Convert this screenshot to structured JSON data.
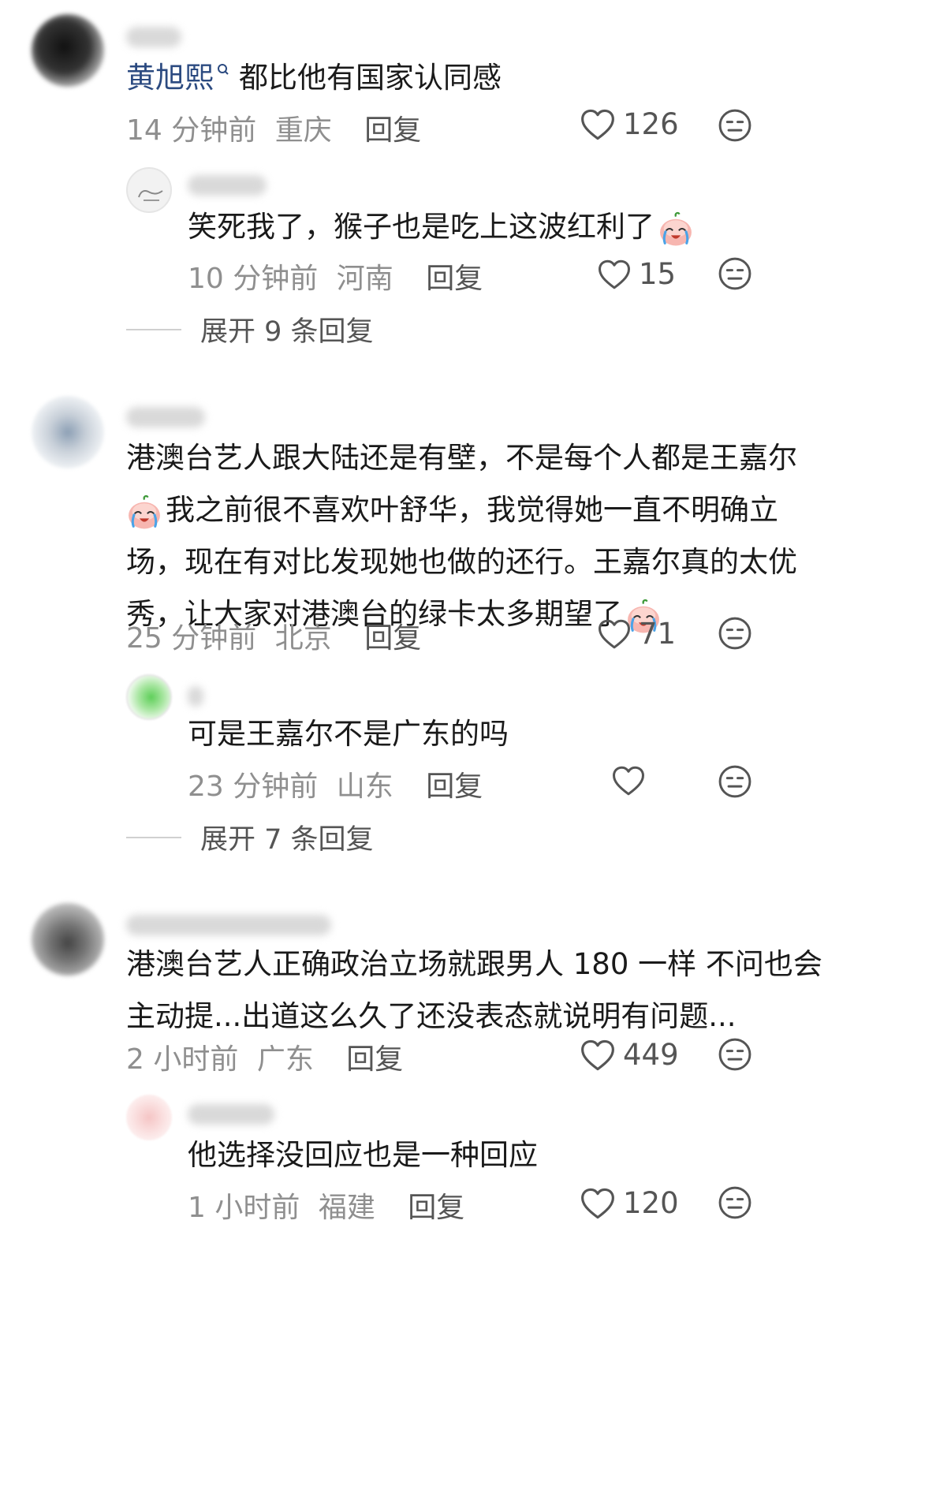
{
  "comments": [
    {
      "mention": "黄旭熙",
      "text": "都比他有国家认同感",
      "time": "14 分钟前",
      "location": "重庆",
      "reply_label": "回复",
      "likes": "126"
    },
    {
      "text": "笑死我了，猴子也是吃上这波红利了",
      "time": "10 分钟前",
      "location": "河南",
      "reply_label": "回复",
      "likes": "15",
      "expand_label": "展开 9 条回复"
    },
    {
      "lines": [
        "港澳台艺人跟大陆还是有壁，不是每个人都是王嘉尔",
        "我之前很不喜欢叶舒华，我觉得她一直不明确立",
        "场，现在有对比发现她也做的还行。王嘉尔真的太优",
        "秀，让大家对港澳台的绿卡太多期望了"
      ],
      "time": "25 分钟前",
      "location": "北京",
      "reply_label": "回复",
      "likes": "71"
    },
    {
      "text": "可是王嘉尔不是广东的吗",
      "time": "23 分钟前",
      "location": "山东",
      "reply_label": "回复",
      "likes": "",
      "expand_label": "展开 7 条回复"
    },
    {
      "lines": [
        "港澳台艺人正确政治立场就跟男人 180 一样 不问也会",
        "主动提...出道这么久了还没表态就说明有问题..."
      ],
      "time": "2 小时前",
      "location": "广东",
      "reply_label": "回复",
      "likes": "449"
    },
    {
      "text": "他选择没回应也是一种回应",
      "time": "1 小时前",
      "location": "福建",
      "reply_label": "回复",
      "likes": "120"
    }
  ],
  "icons": {
    "like": "heart-outline-icon",
    "dislike": "neutral-face-icon",
    "emoji": "crying-laughing-peach-emoji",
    "mention": "search-mention-icon"
  },
  "colors": {
    "mention": "#2b4a80",
    "meta": "#8f8f8f",
    "icon": "#555555"
  }
}
